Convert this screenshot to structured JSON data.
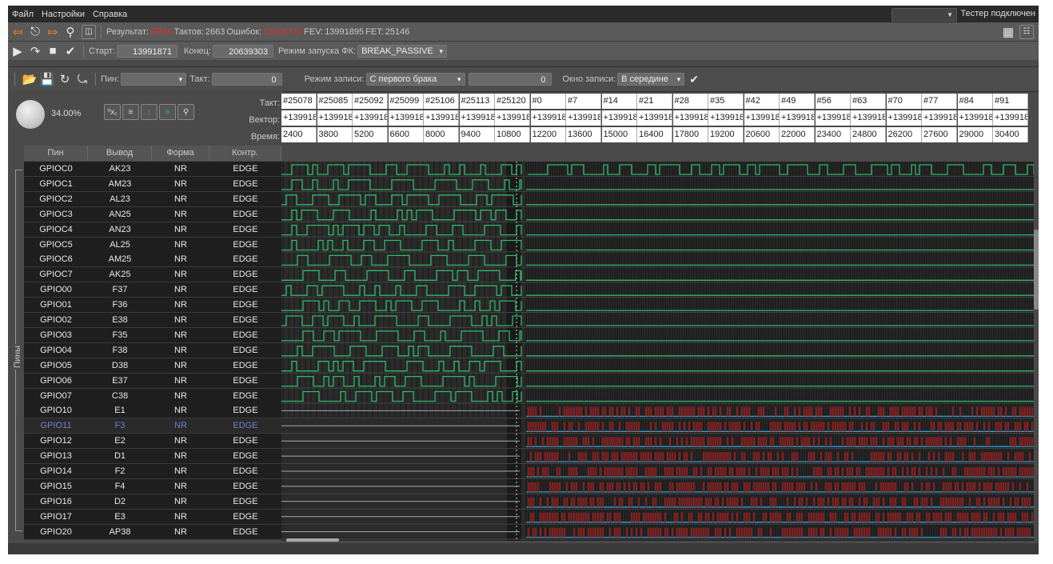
{
  "menu": {
    "file": "Файл",
    "settings": "Настройки",
    "help": "Справка",
    "tester_status": "Тестер подключен"
  },
  "toolbar1": {
    "result_label": "Результат:",
    "result_value": "БРАК",
    "clocks_label": "Тактов:",
    "clocks_value": "2663",
    "errors_label": "Ошибок:",
    "errors_value": "13108732",
    "fev_label": "FEV:",
    "fev_value": "13991895",
    "fet_label": "FET:",
    "fet_value": "25146"
  },
  "toolbar2": {
    "start_label": "Старт:",
    "start_value": "13991871",
    "end_label": "Конец:",
    "end_value": "20639303",
    "mode_label": "Режим запуска ФК:",
    "mode_value": "BREAK_PASSIVE"
  },
  "toolbar3": {
    "pin_label": "Пин:",
    "pin_value": "",
    "clock_label": "Такт:",
    "clock_value": "0",
    "write_mode_label": "Режим записи:",
    "write_mode_value": "С первого брака",
    "write_count_value": "0",
    "window_label": "Окно записи:",
    "window_value": "В середине"
  },
  "view": {
    "zoom_label": "34.00%",
    "row_labels": {
      "clock": "Такт:",
      "vector": "Вектор:",
      "time": "Время:"
    }
  },
  "vectors": {
    "clocks": [
      "#25078",
      "#25085",
      "#25092",
      "#25099",
      "#25106",
      "#25113",
      "#25120",
      "#0",
      "#7",
      "#14",
      "#21",
      "#28",
      "#35",
      "#42",
      "#49",
      "#56",
      "#63",
      "#70",
      "#77",
      "#84",
      "#91"
    ],
    "vector": [
      "+139918",
      "+139918",
      "+139918",
      "+139918",
      "+139918",
      "+139918",
      "+139918",
      "+139918",
      "+139918",
      "+139918",
      "+139918",
      "+139918",
      "+139918",
      "+139918",
      "+139918",
      "+139918",
      "+139918",
      "+139918",
      "+139918",
      "+139918",
      "+139918"
    ],
    "time": [
      "2400",
      "3800",
      "5200",
      "6600",
      "8000",
      "9400",
      "10800",
      "12200",
      "13600",
      "15000",
      "16400",
      "17800",
      "19200",
      "20600",
      "22000",
      "23400",
      "24800",
      "26200",
      "27600",
      "29000",
      "30400"
    ]
  },
  "table": {
    "headers": {
      "pin": "Пин",
      "output": "Вывод",
      "form": "Форма",
      "control": "Контр."
    },
    "group_label": "Пины",
    "rows": [
      {
        "pin": "GPIOC0",
        "out": "AK23",
        "form": "NR",
        "ctrl": "EDGE"
      },
      {
        "pin": "GPIOC1",
        "out": "AM23",
        "form": "NR",
        "ctrl": "EDGE"
      },
      {
        "pin": "GPIOC2",
        "out": "AL23",
        "form": "NR",
        "ctrl": "EDGE"
      },
      {
        "pin": "GPIOC3",
        "out": "AN25",
        "form": "NR",
        "ctrl": "EDGE"
      },
      {
        "pin": "GPIOC4",
        "out": "AN23",
        "form": "NR",
        "ctrl": "EDGE"
      },
      {
        "pin": "GPIOC5",
        "out": "AL25",
        "form": "NR",
        "ctrl": "EDGE"
      },
      {
        "pin": "GPIOC6",
        "out": "AM25",
        "form": "NR",
        "ctrl": "EDGE"
      },
      {
        "pin": "GPIOC7",
        "out": "AK25",
        "form": "NR",
        "ctrl": "EDGE"
      },
      {
        "pin": "GPIO00",
        "out": "F37",
        "form": "NR",
        "ctrl": "EDGE"
      },
      {
        "pin": "GPIO01",
        "out": "F36",
        "form": "NR",
        "ctrl": "EDGE"
      },
      {
        "pin": "GPIO02",
        "out": "E38",
        "form": "NR",
        "ctrl": "EDGE"
      },
      {
        "pin": "GPIO03",
        "out": "F35",
        "form": "NR",
        "ctrl": "EDGE"
      },
      {
        "pin": "GPIO04",
        "out": "F38",
        "form": "NR",
        "ctrl": "EDGE"
      },
      {
        "pin": "GPIO05",
        "out": "D38",
        "form": "NR",
        "ctrl": "EDGE"
      },
      {
        "pin": "GPIO06",
        "out": "E37",
        "form": "NR",
        "ctrl": "EDGE"
      },
      {
        "pin": "GPIO07",
        "out": "C38",
        "form": "NR",
        "ctrl": "EDGE"
      },
      {
        "pin": "GPIO10",
        "out": "E1",
        "form": "NR",
        "ctrl": "EDGE"
      },
      {
        "pin": "GPIO11",
        "out": "F3",
        "form": "NR",
        "ctrl": "EDGE"
      },
      {
        "pin": "GPIO12",
        "out": "E2",
        "form": "NR",
        "ctrl": "EDGE"
      },
      {
        "pin": "GPIO13",
        "out": "D1",
        "form": "NR",
        "ctrl": "EDGE"
      },
      {
        "pin": "GPIO14",
        "out": "F2",
        "form": "NR",
        "ctrl": "EDGE"
      },
      {
        "pin": "GPIO15",
        "out": "F4",
        "form": "NR",
        "ctrl": "EDGE"
      },
      {
        "pin": "GPIO16",
        "out": "D2",
        "form": "NR",
        "ctrl": "EDGE"
      },
      {
        "pin": "GPIO17",
        "out": "E3",
        "form": "NR",
        "ctrl": "EDGE"
      },
      {
        "pin": "GPIO20",
        "out": "AP38",
        "form": "NR",
        "ctrl": "EDGE"
      }
    ],
    "selected_pin": "GPIO11"
  },
  "colors": {
    "wave_green": "#2fb86a",
    "wave_cyan": "#2a9fd6",
    "error_red": "#e0302a",
    "selected_text": "#6f7fd6"
  }
}
